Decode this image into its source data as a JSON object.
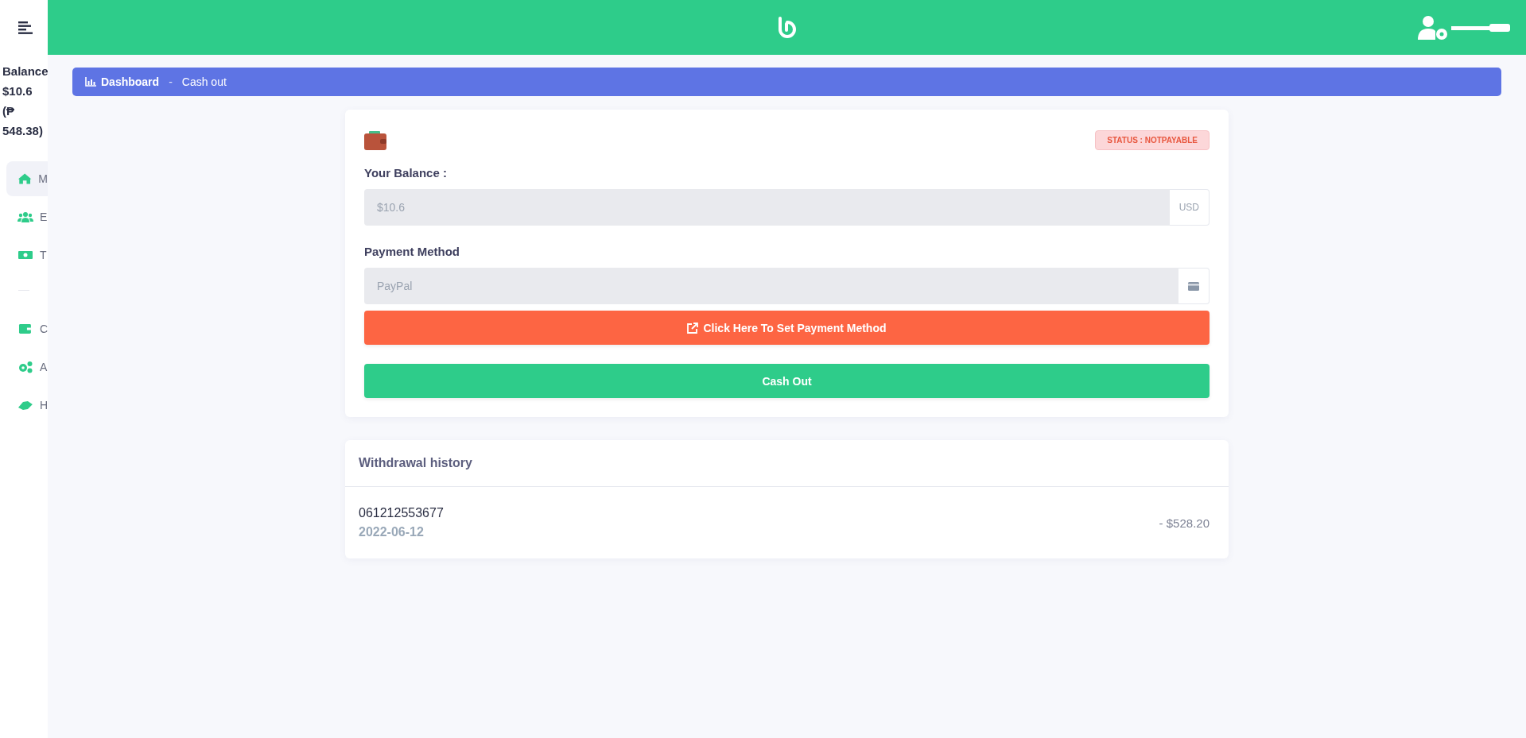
{
  "sidebar": {
    "balance_lines": [
      "Balance",
      "$10.6",
      "(₱",
      "548.38)"
    ],
    "groups": [
      [
        {
          "label": "M",
          "selected": true
        },
        {
          "label": "E",
          "selected": false
        },
        {
          "label": "T",
          "selected": false
        }
      ],
      [
        {
          "label": "C",
          "selected": false
        },
        {
          "label": "A",
          "selected": false
        },
        {
          "label": "H",
          "selected": false
        }
      ]
    ]
  },
  "breadcrumb": {
    "items": [
      "Dashboard",
      "Cash out"
    ],
    "separator": "-"
  },
  "cashout": {
    "status": "STATUS : NOTPAYABLE",
    "balance_label": "Your Balance :",
    "balance_value": "$10.6",
    "balance_unit": "USD",
    "method_label": "Payment Method",
    "method_value": "PayPal",
    "set_method_button": "Click Here To Set Payment Method",
    "cashout_button": "Cash Out"
  },
  "history": {
    "title": "Withdrawal history",
    "rows": [
      {
        "id": "061212553677",
        "date": "2022-06-12",
        "amount": "- $528.20"
      }
    ]
  }
}
